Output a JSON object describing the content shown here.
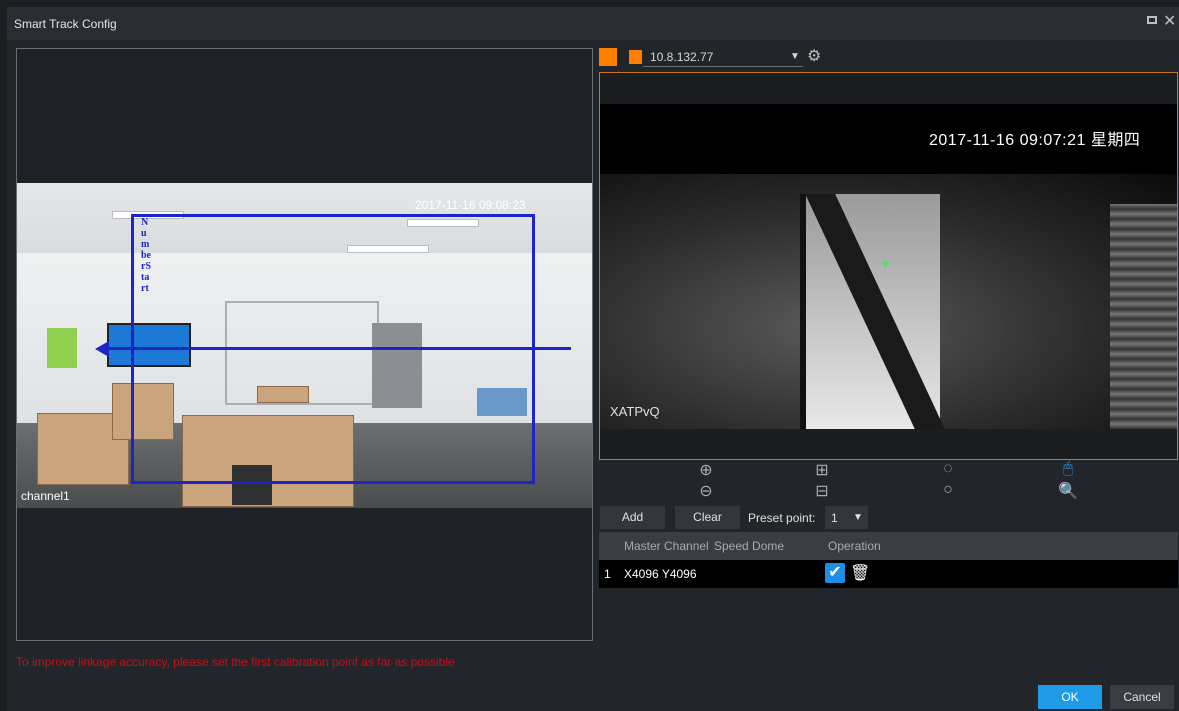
{
  "window": {
    "title": "Smart Track Config"
  },
  "left_video": {
    "timestamp": "2017-11-16 09:08:23",
    "channel": "channel1",
    "track_label": "NumberStart"
  },
  "hint": "To improve linkage accuracy, please set the first calibration point as far as possible",
  "camera": {
    "ip": "10.8.132.77",
    "accent_color": "#ff7f00"
  },
  "right_video": {
    "timestamp": "2017-11-16 09:07:21 星期四",
    "watermark": "XATPvQ",
    "crosshair": "+"
  },
  "controls": {
    "zoom_in": "⊕",
    "zoom_out": "⊖",
    "focus_near": "⊞",
    "focus_far": "⊟",
    "iris_open": "◌",
    "iris_close": "○",
    "mouse": "🖱",
    "search": "🔍"
  },
  "calibration": {
    "add_label": "Add",
    "clear_label": "Clear",
    "preset_label": "Preset point:",
    "preset_value": "1",
    "columns": [
      "Master Channel",
      "Speed Dome",
      "Operation"
    ],
    "rows": [
      {
        "index": "1",
        "master_channel": "X4096 Y4096",
        "speed_dome": ""
      }
    ]
  },
  "footer": {
    "ok_label": "OK",
    "cancel_label": "Cancel"
  }
}
